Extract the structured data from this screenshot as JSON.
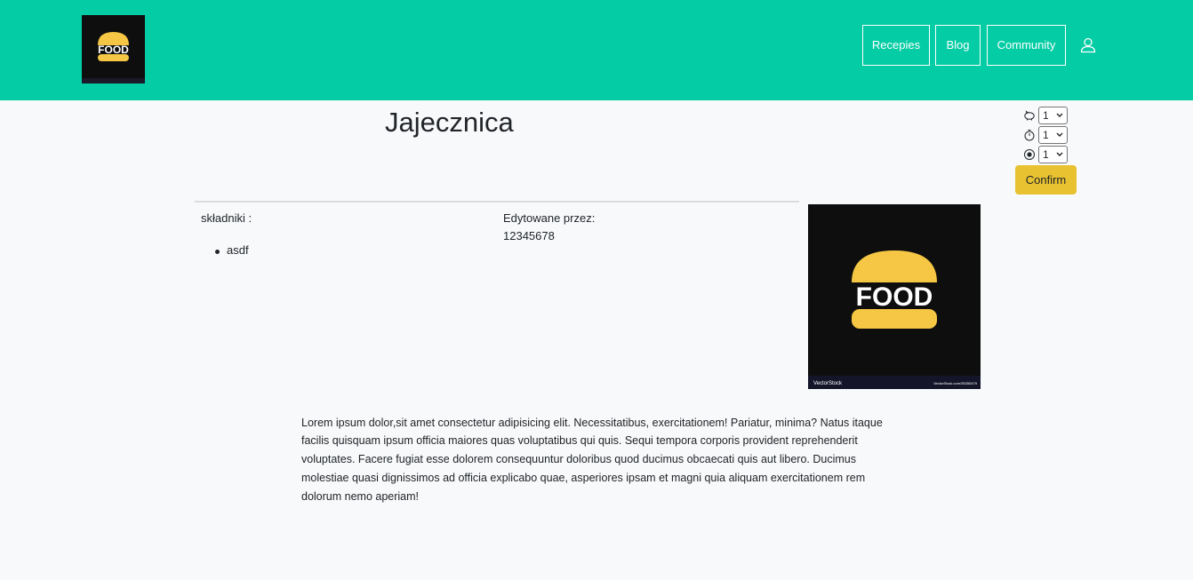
{
  "header": {
    "logo_alt": "FOOD",
    "nav": [
      {
        "label": "Recepies"
      },
      {
        "label": "Blog"
      },
      {
        "label": "Community"
      }
    ]
  },
  "recipe": {
    "title": "Jajecznica",
    "controls": [
      {
        "icon": "piggy-bank-icon",
        "value": "1"
      },
      {
        "icon": "stopwatch-icon",
        "value": "1"
      },
      {
        "icon": "difficulty-icon",
        "value": "1"
      }
    ],
    "confirm_label": "Confirm",
    "ingredients_label": "składniki :",
    "ingredients": [
      "asdf"
    ],
    "edited_by_label": "Edytowane przez:",
    "edited_by_user": "12345678",
    "image_logo_text": "FOOD",
    "image_watermark_left": "VectorStock",
    "image_watermark_right": "VectorStock.com/35355479",
    "description": "Lorem ipsum dolor,sit amet consectetur adipisicing elit. Necessitatibus, exercitationem! Pariatur, minima? Natus itaque facilis quisquam ipsum officia maiores quas voluptatibus qui quis. Sequi tempora corporis provident reprehenderit voluptates. Facere fugiat esse dolorem consequuntur doloribus quod ducimus obcaecati quis aut libero. Ducimus molestiae quasi dignissimos ad officia explicabo quae, asperiores ipsam et magni quia aliquam exercitationem rem dolorum nemo aperiam!"
  },
  "colors": {
    "navbar": "#04cca4",
    "confirm": "#e8c230",
    "burger": "#f6c744",
    "logo_bg": "#0e0e0e"
  }
}
